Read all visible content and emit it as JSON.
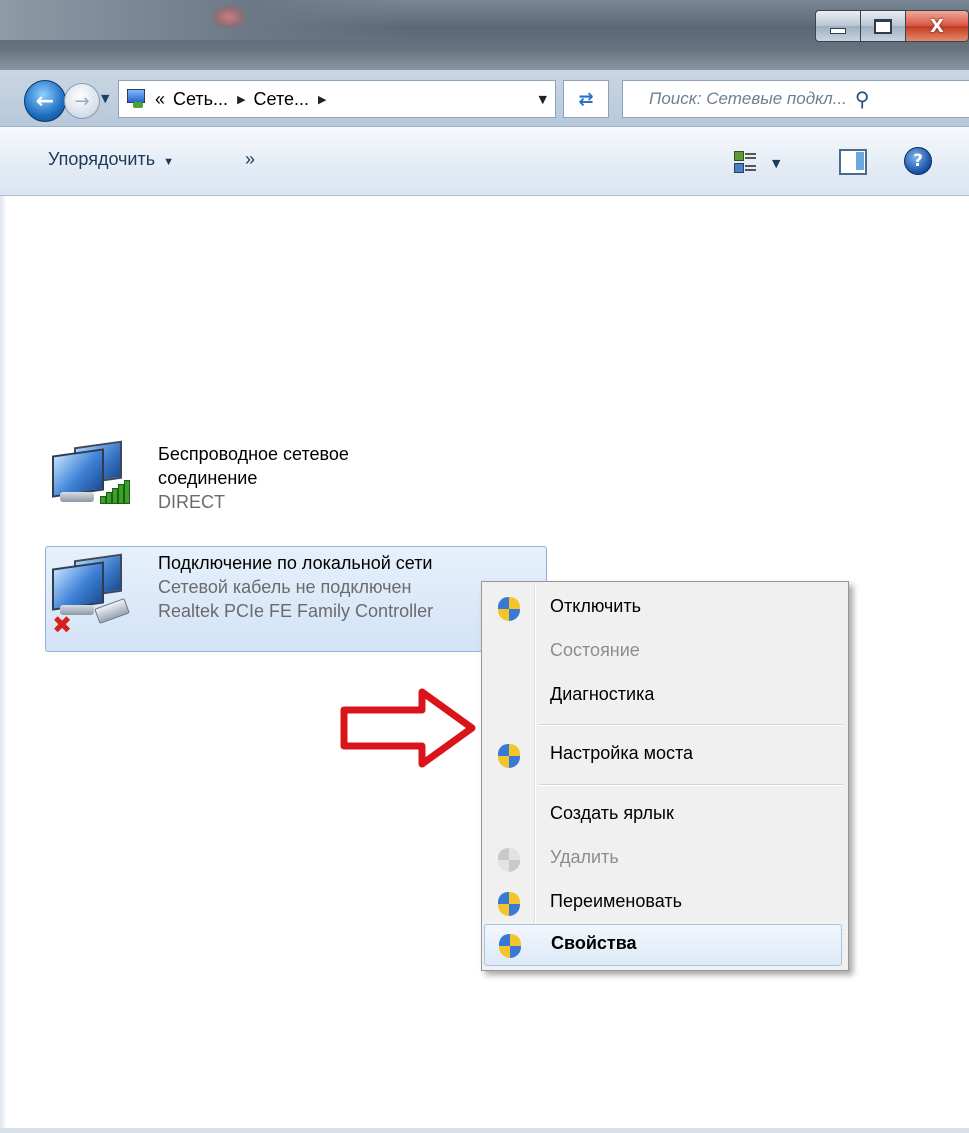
{
  "window": {
    "minimize_icon": "minimize-icon",
    "maximize_icon": "maximize-icon",
    "close_glyph": "X"
  },
  "address": {
    "prefix": "«",
    "crumbs": [
      "Сеть...",
      "Сете..."
    ],
    "search_placeholder": "Поиск: Сетевые подкл..."
  },
  "toolbar": {
    "organize_label": "Упорядочить",
    "more_label": "»",
    "help_label": "?"
  },
  "items": [
    {
      "title_line1": "Беспроводное сетевое",
      "title_line2": "соединение",
      "status": "DIRECT"
    },
    {
      "title": "Подключение по локальной сети",
      "status": "Сетевой кабель не подключен",
      "adapter": "Realtek PCIe FE Family Controller"
    }
  ],
  "context_menu": {
    "items": [
      {
        "label": "Отключить",
        "icon": "uac-shield-icon",
        "enabled": true
      },
      {
        "label": "Состояние",
        "icon": "",
        "enabled": false
      },
      {
        "label": "Диагностика",
        "icon": "",
        "enabled": true
      },
      {
        "label": "Настройка моста",
        "icon": "uac-shield-icon",
        "enabled": true
      },
      {
        "label": "Создать ярлык",
        "icon": "",
        "enabled": true
      },
      {
        "label": "Удалить",
        "icon": "uac-shield-icon",
        "enabled": false
      },
      {
        "label": "Переименовать",
        "icon": "uac-shield-icon",
        "enabled": true
      },
      {
        "label": "Свойства",
        "icon": "uac-shield-icon",
        "enabled": true,
        "default": true,
        "highlighted": true
      }
    ]
  },
  "colors": {
    "annotation_arrow": "#d9141b",
    "selection_bg": "#d3e3f6",
    "menu_bg": "#f0f0f0"
  }
}
